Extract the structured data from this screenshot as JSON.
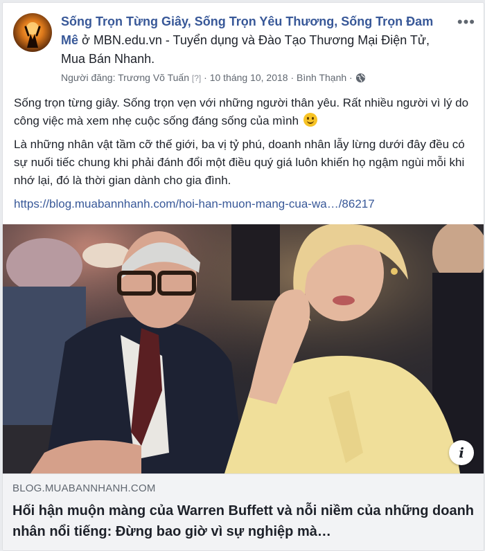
{
  "post": {
    "page_name": "Sống Trọn Từng Giây, Sống Trọn Yêu Thương, Sống Trọn Đam Mê",
    "at_word": " ở ",
    "location": "MBN.edu.vn - Tuyển dụng và Đào Tạo Thương Mại Điện Tử, Mua Bán Nhanh.",
    "author_prefix": "Người đăng: ",
    "author": "Trương Võ Tuấn",
    "author_help": "[?]",
    "separator": " · ",
    "date": "10 tháng 10, 2018",
    "place": "Bình Thạnh",
    "more_icon": "ellipsis-icon",
    "privacy_icon": "globe-icon"
  },
  "body": {
    "paragraph1": "Sống trọn từng giây. Sống trọn vẹn với những người thân yêu. Rất nhiều người vì lý do công việc mà xem nhẹ cuộc sống đáng sống của mình",
    "paragraph2": "Là những nhân vật tầm cỡ thế giới, ba vị tỷ phú, doanh nhân lẫy lừng dưới đây đều có sự nuối tiếc chung khi phải đánh đổi một điều quý giá luôn khiến họ ngậm ngùi mỗi khi nhớ lại, đó là thời gian dành cho gia đình.",
    "link": "https://blog.muabannhanh.com/hoi-han-muon-mang-cua-wa…/86217"
  },
  "card": {
    "domain": "BLOG.MUABANNHANH.COM",
    "title": "Hối hận muộn màng của Warren Buffett và nỗi niềm của những doanh nhân nổi tiếng: Đừng bao giờ vì sự nghiệp mà…",
    "info_label": "i"
  },
  "colors": {
    "link": "#385898",
    "text": "#1d2129",
    "meta": "#606770",
    "card_bg": "#f2f3f5"
  }
}
